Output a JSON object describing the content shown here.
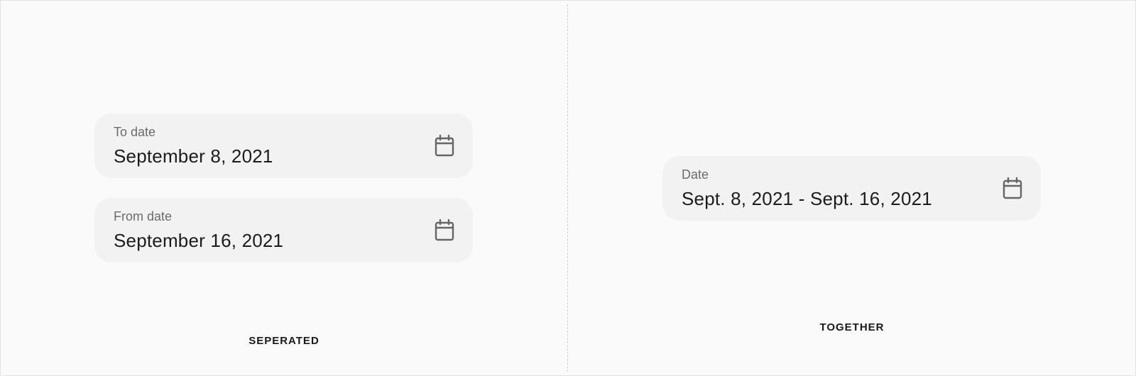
{
  "separated": {
    "caption": "SEPERATED",
    "to_date": {
      "label": "To date",
      "value": "September 8, 2021",
      "icon": "calendar-icon"
    },
    "from_date": {
      "label": "From date",
      "value": "September 16, 2021",
      "icon": "calendar-icon"
    }
  },
  "together": {
    "caption": "TOGETHER",
    "date_range": {
      "label": "Date",
      "value": "Sept. 8, 2021 - Sept. 16, 2021",
      "icon": "calendar-icon"
    }
  },
  "colors": {
    "background": "#fafafa",
    "field_background": "#f2f2f2",
    "label_text": "#6b6b6b",
    "value_text": "#1c1c1c",
    "icon": "#666666",
    "divider": "#cfcfcf"
  }
}
